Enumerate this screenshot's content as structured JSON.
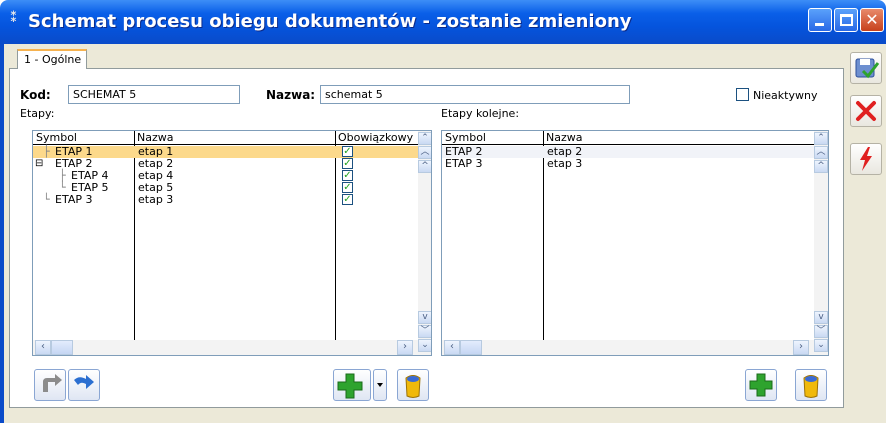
{
  "window": {
    "title": "Schemat procesu obiegu dokumentów - zostanie zmieniony"
  },
  "tab": {
    "label": "1 - Ogólne"
  },
  "form": {
    "kod_label": "Kod:",
    "kod_value": "SCHEMAT 5",
    "nazwa_label": "Nazwa:",
    "nazwa_value": "schemat 5",
    "nieaktywny_label": "Nieaktywny",
    "nieaktywny_checked": false
  },
  "etapy": {
    "label": "Etapy:",
    "columns": [
      "Symbol",
      "Nazwa",
      "Obowiązkowy"
    ],
    "rows": [
      {
        "symbol": "ETAP 1",
        "nazwa": "etap 1",
        "obowiazkowy": true,
        "selected": true
      },
      {
        "symbol": "ETAP 2",
        "nazwa": "etap 2",
        "obowiazkowy": true,
        "expander": "minus"
      },
      {
        "symbol": "ETAP 4",
        "nazwa": "etap 4",
        "obowiazkowy": true
      },
      {
        "symbol": "ETAP 5",
        "nazwa": "etap 5",
        "obowiazkowy": true
      },
      {
        "symbol": "ETAP 3",
        "nazwa": "etap 3",
        "obowiazkowy": true
      }
    ]
  },
  "kolejne": {
    "label": "Etapy kolejne:",
    "columns": [
      "Symbol",
      "Nazwa"
    ],
    "rows": [
      {
        "symbol": "ETAP 2",
        "nazwa": "etap 2",
        "selected": true
      },
      {
        "symbol": "ETAP 3",
        "nazwa": "etap 3"
      }
    ]
  },
  "icons": {
    "undo": "undo-arrow-icon",
    "redo": "redo-arrow-icon",
    "add": "green-plus-icon",
    "delete": "trash-bin-icon",
    "save": "save-diskette-icon",
    "cancel": "red-x-icon",
    "action": "lightning-icon"
  },
  "colors": {
    "titlebar": "#0554dd",
    "selection": "#fcd98b",
    "window_bg": "#ece9d8"
  }
}
